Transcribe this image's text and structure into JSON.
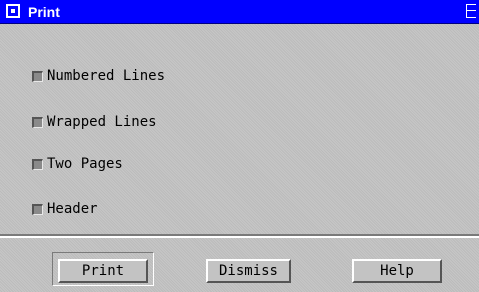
{
  "window": {
    "title": "Print",
    "titlebar_color": "#0000ff",
    "background_color": "#c3c3c3"
  },
  "options": [
    {
      "label": "Numbered Lines",
      "checked": false
    },
    {
      "label": "Wrapped Lines",
      "checked": false
    },
    {
      "label": "Two Pages",
      "checked": false
    },
    {
      "label": "Header",
      "checked": false
    }
  ],
  "buttons": {
    "print_label": "Print",
    "dismiss_label": "Dismiss",
    "help_label": "Help",
    "default": "Print"
  },
  "icons": {
    "window_menu": "window-menu-icon",
    "resize": "resize-icon"
  }
}
